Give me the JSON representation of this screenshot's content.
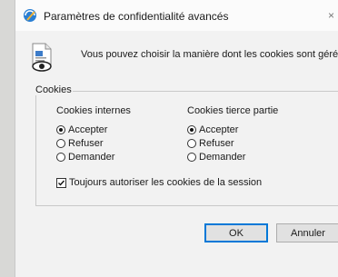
{
  "window": {
    "title": "Paramètres de confidentialité avancés",
    "close_label": "×",
    "title_icon": "privacy-settings-icon"
  },
  "description": {
    "icon": "privacy-document-eye-icon",
    "text": "Vous pouvez choisir la manière dont les cookies sont gérés."
  },
  "cookies_group": {
    "legend": "Cookies",
    "first_party": {
      "header": "Cookies internes",
      "options": [
        "Accepter",
        "Refuser",
        "Demander"
      ],
      "selected": "Accepter"
    },
    "third_party": {
      "header": "Cookies tierce partie",
      "options": [
        "Accepter",
        "Refuser",
        "Demander"
      ],
      "selected": "Accepter"
    },
    "session_checkbox": {
      "label": "Toujours autoriser les cookies de la session",
      "checked": true
    }
  },
  "buttons": {
    "ok": "OK",
    "cancel": "Annuler"
  }
}
